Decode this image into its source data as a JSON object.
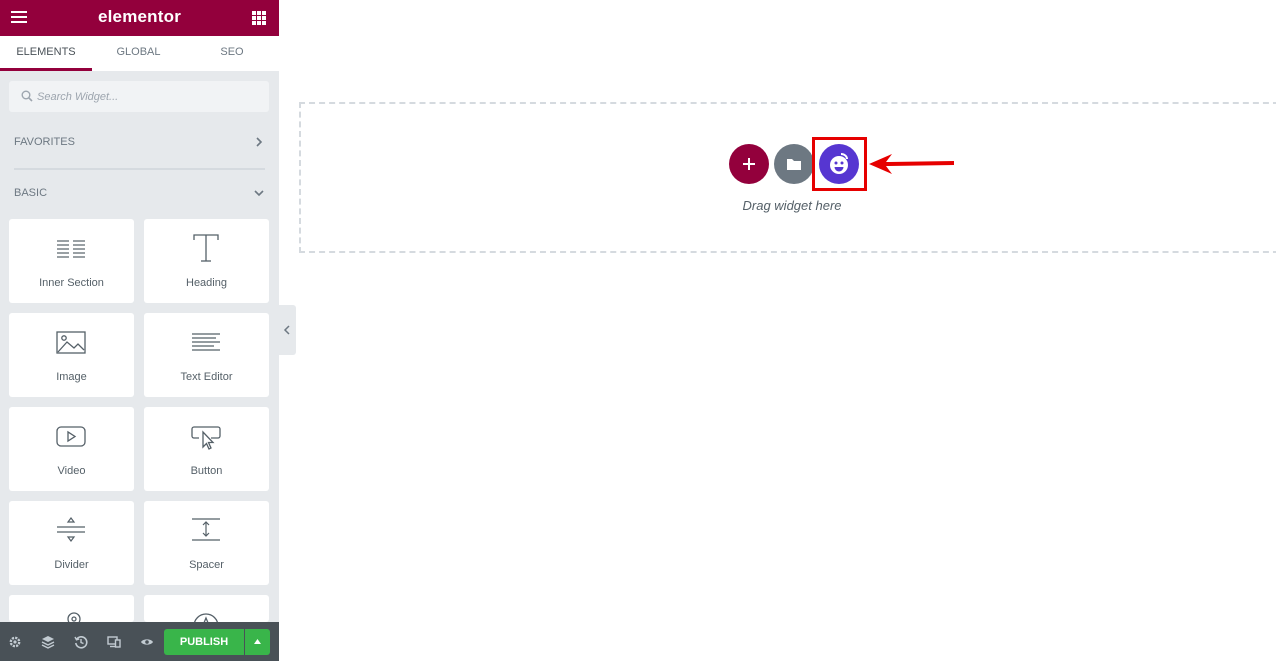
{
  "header": {
    "logo": "elementor",
    "menu_icon": "hamburger-menu-icon",
    "apps_icon": "grid-apps-icon",
    "brand_color": "#93003c"
  },
  "tabs": [
    {
      "label": "ELEMENTS",
      "active": true
    },
    {
      "label": "GLOBAL",
      "active": false
    },
    {
      "label": "SEO",
      "active": false
    }
  ],
  "search": {
    "placeholder": "Search Widget...",
    "value": ""
  },
  "categories": {
    "favorites": {
      "label": "FAVORITES",
      "expanded": false
    },
    "basic": {
      "label": "BASIC",
      "expanded": true
    }
  },
  "widgets": [
    {
      "label": "Inner Section",
      "icon": "inner-section-icon"
    },
    {
      "label": "Heading",
      "icon": "heading-icon"
    },
    {
      "label": "Image",
      "icon": "image-icon"
    },
    {
      "label": "Text Editor",
      "icon": "text-editor-icon"
    },
    {
      "label": "Video",
      "icon": "video-icon"
    },
    {
      "label": "Button",
      "icon": "button-icon"
    },
    {
      "label": "Divider",
      "icon": "divider-icon"
    },
    {
      "label": "Spacer",
      "icon": "spacer-icon"
    },
    {
      "label": "",
      "icon": "google-maps-icon"
    },
    {
      "label": "",
      "icon": "icon-widget-icon"
    }
  ],
  "footer": {
    "icons": [
      "settings-icon",
      "navigator-icon",
      "history-icon",
      "responsive-mode-icon",
      "preview-icon"
    ],
    "publish_label": "PUBLISH",
    "publish_color": "#39b54a"
  },
  "canvas": {
    "drag_text": "Drag widget here",
    "add_section_color": "#93003c",
    "template_library_color": "#6d7882",
    "emoji_widget_color": "#5636d1",
    "highlight_color": "#e60000"
  }
}
